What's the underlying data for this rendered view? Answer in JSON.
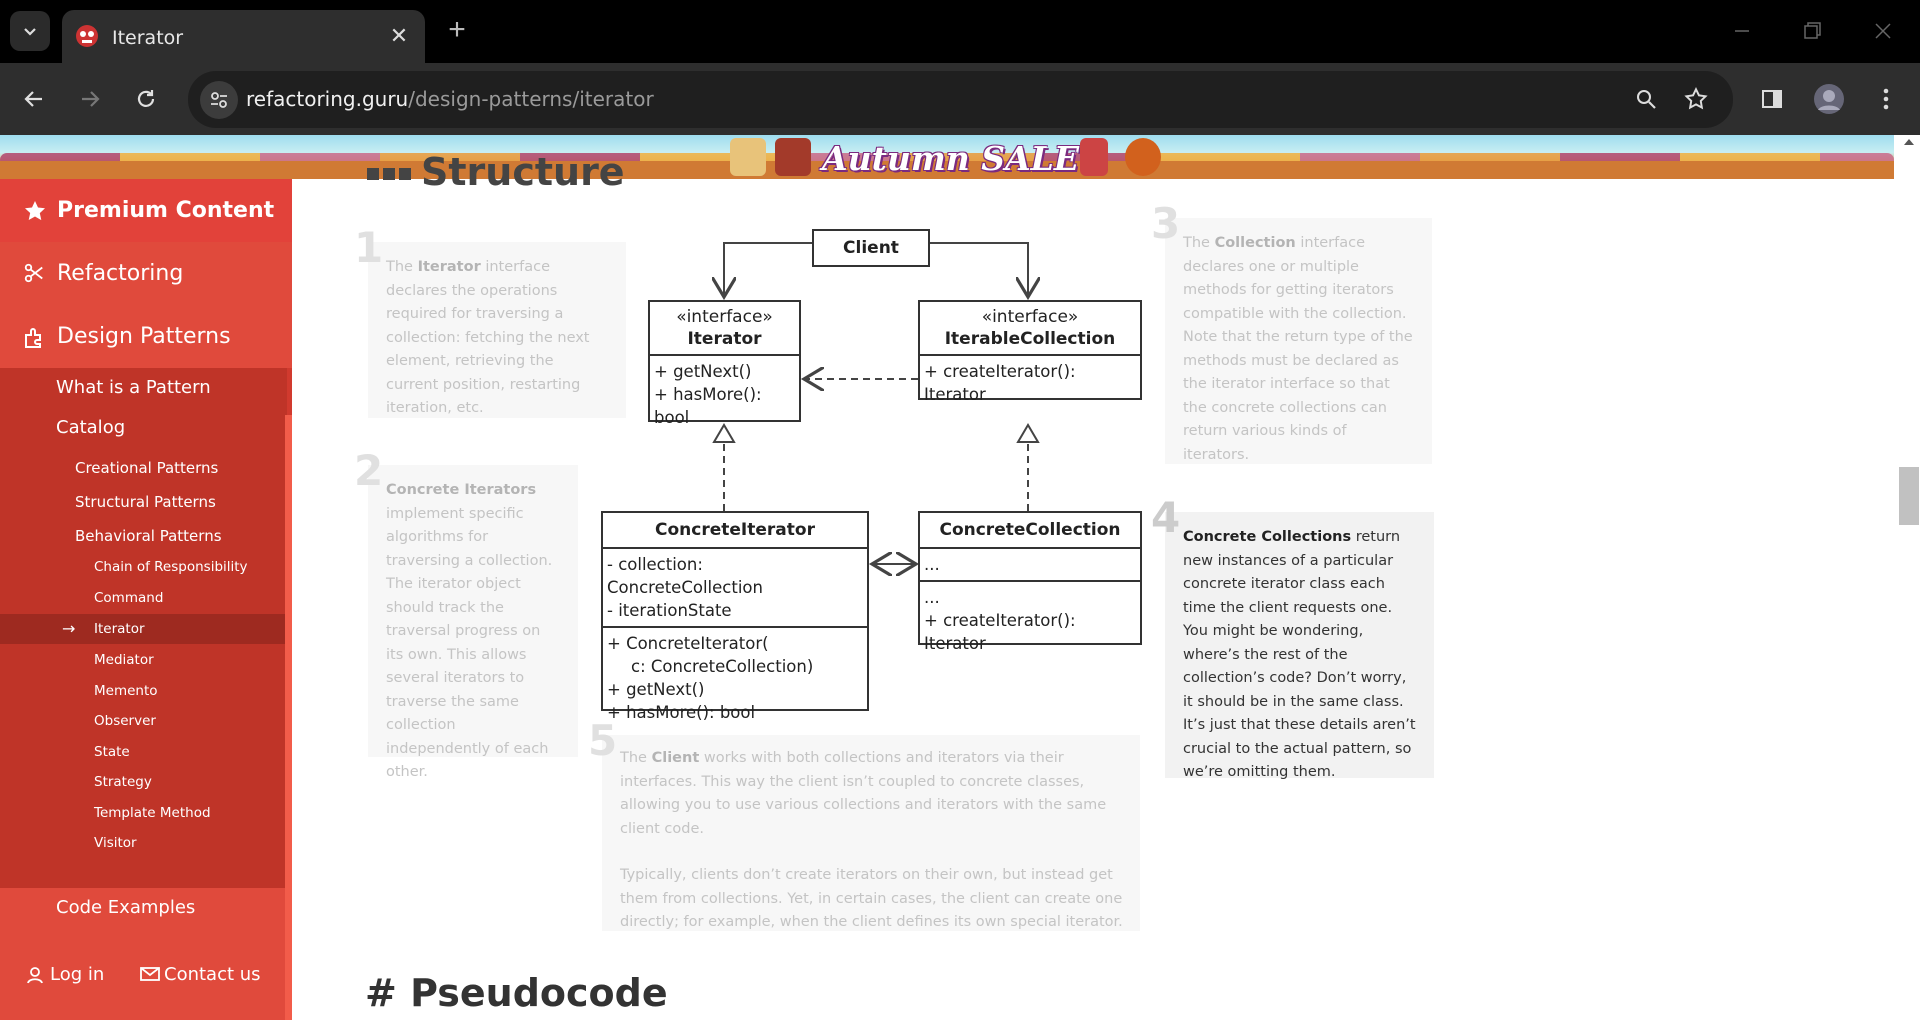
{
  "browser": {
    "tab_title": "Iterator",
    "url_host": "refactoring.guru",
    "url_path": "/design-patterns/iterator"
  },
  "banner": {
    "text": "Autumn SALE"
  },
  "sidebar": {
    "premium": "Premium Content",
    "refactoring": "Refactoring",
    "design_patterns": "Design Patterns",
    "what_is": "What is a Pattern",
    "catalog": "Catalog",
    "creational": "Creational Patterns",
    "structural": "Structural Patterns",
    "behavioral": "Behavioral Patterns",
    "behavioral_items": [
      "Chain of Responsibility",
      "Command",
      "Iterator",
      "Mediator",
      "Memento",
      "Observer",
      "State",
      "Strategy",
      "Template Method",
      "Visitor"
    ],
    "active_arrow": "→",
    "code_examples": "Code Examples",
    "login": "Log in",
    "contact": "Contact us"
  },
  "content": {
    "structure_title": "Structure",
    "pseudocode_title": "# Pseudocode",
    "notes": [
      {
        "num": "1",
        "lead": "The ",
        "bold": "Iterator",
        "rest": " interface declares the operations required for traversing a collection: fetching the next element, retrieving the current position, restarting iteration, etc."
      },
      {
        "num": "2",
        "lead": "",
        "bold": "Concrete Iterators",
        "rest": " implement specific algorithms for traversing a collection. The iterator object should track the traversal progress on its own. This allows several iterators to traverse the same collection independently of each other."
      },
      {
        "num": "3",
        "lead": "The ",
        "bold": "Collection",
        "rest": " interface declares one or multiple methods for getting iterators compatible with the collection. Note that the return type of the methods must be declared as the iterator interface so that the concrete collections can return various kinds of iterators."
      },
      {
        "num": "4",
        "lead": "",
        "bold": "Concrete Collections",
        "rest": " return new instances of a particular concrete iterator class each time the client requests one. You might be wondering, where’s the rest of the collection’s code? Don’t worry, it should be in the same class. It’s just that these details aren’t crucial to the actual pattern, so we’re omitting them."
      },
      {
        "num": "5",
        "lead": "The ",
        "bold": "Client",
        "rest": " works with both collections and iterators via their interfaces. This way the client isn’t coupled to concrete classes, allowing you to use various collections and iterators with the same client code.",
        "para2": "Typically, clients don’t create iterators on their own, but instead get them from collections. Yet, in certain cases, the client can create one directly; for example, when the client defines its own special iterator."
      }
    ],
    "uml": {
      "client": "Client",
      "iterator_stereo": "«interface»",
      "iterator_name": "Iterator",
      "iterator_m1": "+ getNext()",
      "iterator_m2": "+ hasMore(): bool",
      "coll_stereo": "«interface»",
      "coll_name": "IterableCollection",
      "coll_m1": "+ createIterator(): Iterator",
      "ci_name": "ConcreteIterator",
      "ci_f1": "- collection: ConcreteCollection",
      "ci_f2": "- iterationState",
      "ci_m1": "+ ConcreteIterator(",
      "ci_m2": "c: ConcreteCollection)",
      "ci_m3": "+ getNext()",
      "ci_m4": "+ hasMore(): bool",
      "cc_name": "ConcreteCollection",
      "cc_f1": "...",
      "cc_m1": "...",
      "cc_m2": "+ createIterator(): Iterator"
    }
  }
}
